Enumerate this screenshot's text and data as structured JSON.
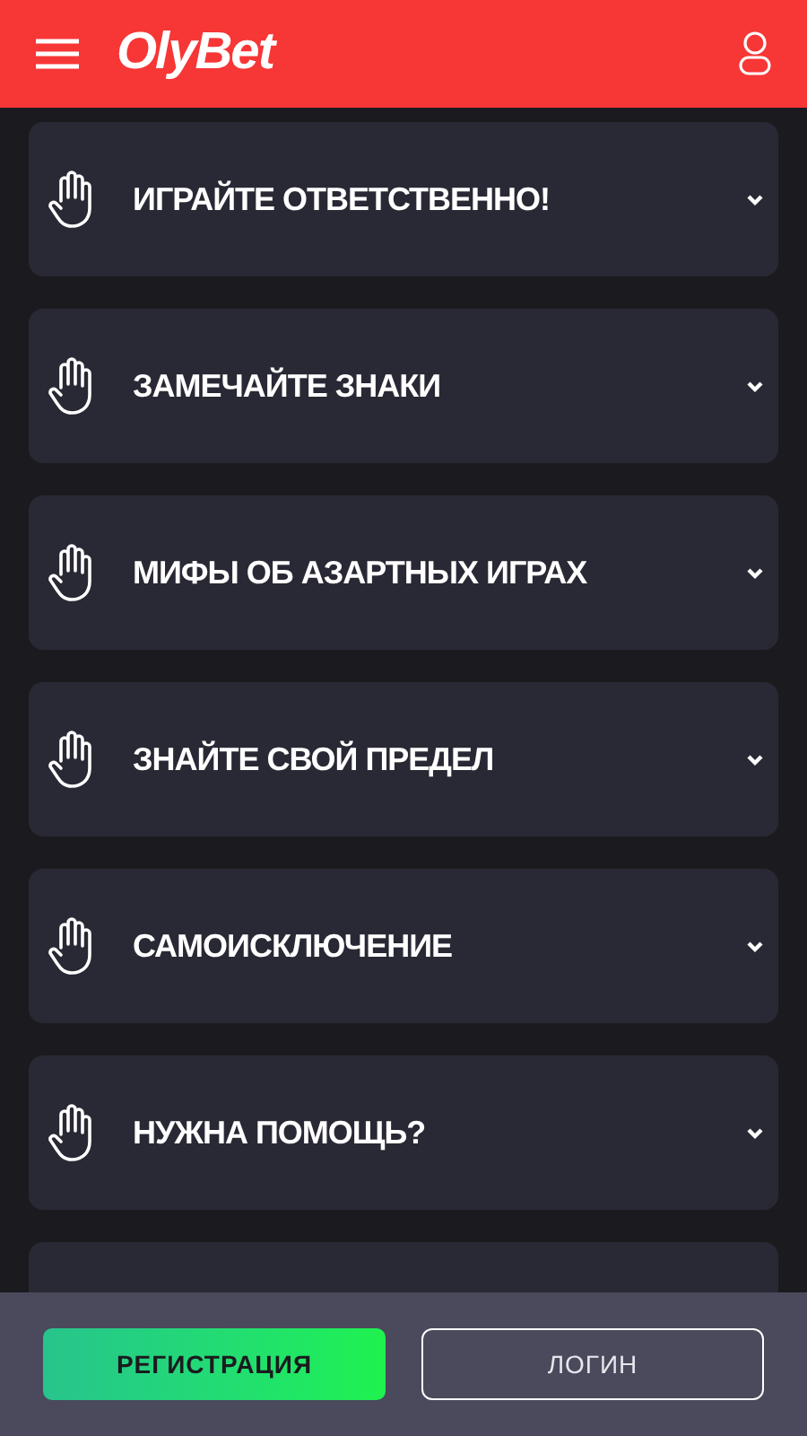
{
  "header": {
    "logo": "OlyBet"
  },
  "sections": [
    {
      "title": "ИГРАЙТЕ ОТВЕТСТВЕННО!"
    },
    {
      "title": "ЗАМЕЧАЙТЕ ЗНАКИ"
    },
    {
      "title": "МИФЫ ОБ АЗАРТНЫХ ИГРАХ"
    },
    {
      "title": "ЗНАЙТЕ СВОЙ ПРЕДЕЛ"
    },
    {
      "title": "САМОИСКЛЮЧЕНИЕ"
    },
    {
      "title": "НУЖНА ПОМОЩЬ?"
    }
  ],
  "footer": {
    "register": "РЕГИСТРАЦИЯ",
    "login": "ЛОГИН"
  }
}
